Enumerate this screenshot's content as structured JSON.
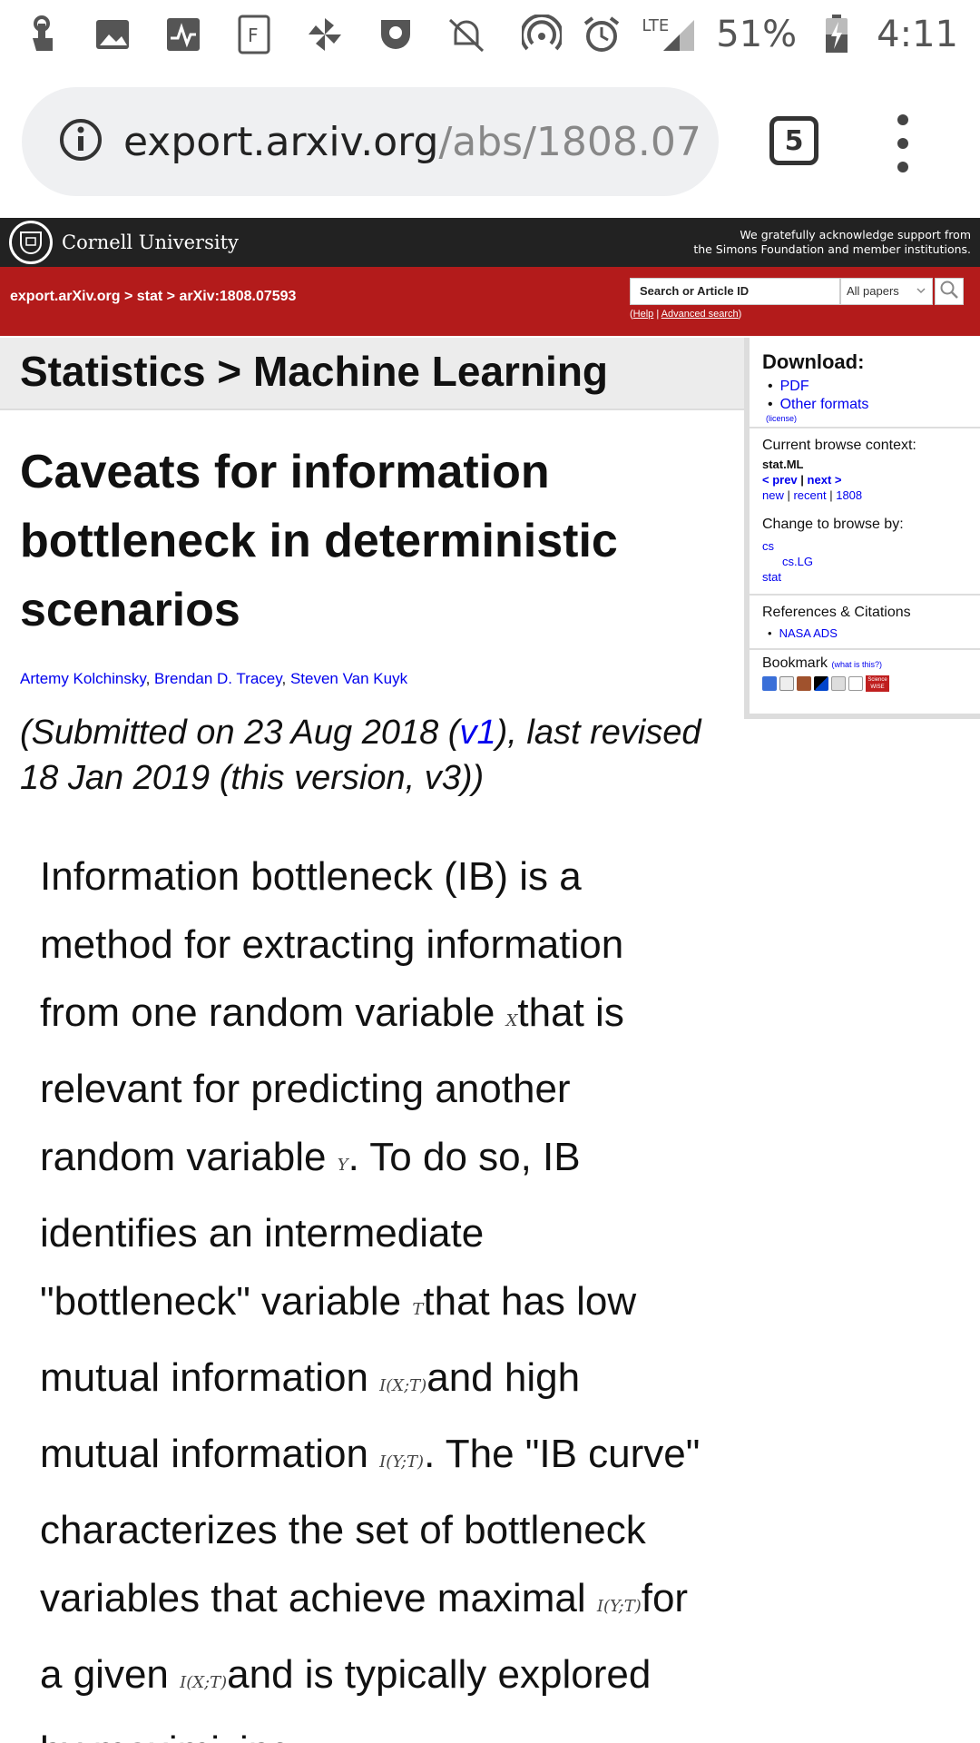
{
  "status_bar": {
    "network": "LTE",
    "battery": "51%",
    "time": "4:11"
  },
  "browser": {
    "url_host": "export.arxiv.org",
    "url_path": "/abs/1808.07",
    "tab_count": "5"
  },
  "cornell": {
    "name": "Cornell University",
    "ack_line1": "We gratefully acknowledge support from",
    "ack_line2": "the Simons Foundation and member institutions."
  },
  "arxiv_bar": {
    "breadcrumb": "export.arXiv.org > stat > arXiv:1808.07593",
    "search_placeholder": "Search or Article ID",
    "search_scope": "All papers",
    "help": "Help",
    "advanced": "Advanced search"
  },
  "heading": "Statistics > Machine Learning",
  "paper": {
    "title": "Caveats for information bottleneck in deterministic scenarios",
    "authors": [
      "Artemy Kolchinsky",
      "Brendan D. Tracey",
      "Steven Van Kuyk"
    ],
    "date_pre": "(Submitted on 23 Aug 2018 (",
    "date_v1": "v1",
    "date_post": "), last revised 18 Jan 2019 (this version, v3))"
  },
  "abstract": {
    "p1": "Information bottleneck (IB) is a method for extracting information from one random variable ",
    "m1": "X",
    "p2": "that is relevant for predicting another random variable ",
    "m2": "Y",
    "p3": ". To do so, IB identifies an intermediate \"bottleneck\" variable ",
    "m3": "T",
    "p4": "that has low mutual information ",
    "m4": "I(X;T)",
    "p5": "and high mutual information ",
    "m5": "I(Y;T)",
    "p6": ". The \"IB curve\" characterizes the set of bottleneck variables that achieve maximal ",
    "m6": "I(Y;T)",
    "p7": "for a given ",
    "m7": "I(X;T)",
    "p8": "and is typically explored by maximizing"
  },
  "sidebar": {
    "download_title": "Download:",
    "download_items": [
      "PDF",
      "Other formats"
    ],
    "license": "(license)",
    "context_label": "Current browse context:",
    "context_value": "stat.ML",
    "prev": "< prev",
    "next": "next >",
    "new": "new",
    "recent": "recent",
    "month": "1808",
    "change_label": "Change to browse by:",
    "change_items": [
      "cs",
      "cs.LG",
      "stat"
    ],
    "refs_label": "References & Citations",
    "refs_item": "NASA ADS",
    "bookmark_label": "Bookmark",
    "bookmark_what": "(what is this?)",
    "bookmark_sd_label": "Science WISE"
  },
  "colors": {
    "arxiv_red": "#b31b1b",
    "cornell_black": "#222222",
    "link_blue": "#0000ee"
  }
}
